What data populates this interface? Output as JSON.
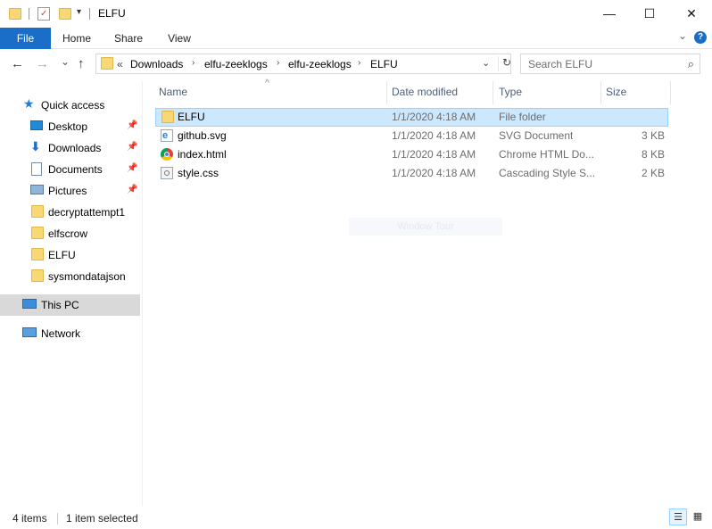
{
  "window": {
    "title": "ELFU",
    "minimize_glyph": "—",
    "maximize_glyph": "☐",
    "close_glyph": "✕"
  },
  "quick_access_toolbar": {
    "dropdown_glyph": "▾"
  },
  "ribbon": {
    "tabs": [
      "File",
      "Home",
      "Share",
      "View"
    ],
    "collapse_glyph": "⌄",
    "help_glyph": "?"
  },
  "navigation": {
    "back_glyph": "←",
    "forward_glyph": "→",
    "recent_glyph": "⌄",
    "up_glyph": "↑",
    "overflow": "«",
    "breadcrumbs": [
      "Downloads",
      "elfu-zeeklogs",
      "elfu-zeeklogs",
      "ELFU"
    ],
    "crumb_separator": "›",
    "dropdown_glyph": "⌄",
    "refresh_glyph": "↻"
  },
  "search": {
    "placeholder": "Search ELFU",
    "icon_glyph": "⌕"
  },
  "sidebar": {
    "pin_glyph": "📌",
    "quick_access_label": "Quick access",
    "items": [
      {
        "label": "Desktop",
        "icon": "desktop-icon",
        "pinned": true
      },
      {
        "label": "Downloads",
        "icon": "downloads-icon",
        "pinned": true
      },
      {
        "label": "Documents",
        "icon": "documents-icon",
        "pinned": true
      },
      {
        "label": "Pictures",
        "icon": "pictures-icon",
        "pinned": true
      },
      {
        "label": "decryptattempt1",
        "icon": "folder-icon",
        "pinned": false
      },
      {
        "label": "elfscrow",
        "icon": "folder-icon",
        "pinned": false
      },
      {
        "label": "ELFU",
        "icon": "folder-icon",
        "pinned": false
      },
      {
        "label": "sysmondatajson",
        "icon": "folder-icon",
        "pinned": false
      }
    ],
    "this_pc_label": "This PC",
    "network_label": "Network"
  },
  "file_list": {
    "sort_glyph": "^",
    "columns": [
      "Name",
      "Date modified",
      "Type",
      "Size"
    ],
    "rows": [
      {
        "name": "ELFU",
        "modified": "1/1/2020 4:18 AM",
        "type": "File folder",
        "size": "",
        "icon": "folder-icon",
        "selected": true
      },
      {
        "name": "github.svg",
        "modified": "1/1/2020 4:18 AM",
        "type": "SVG Document",
        "size": "3 KB",
        "icon": "ie-document-icon",
        "selected": false
      },
      {
        "name": "index.html",
        "modified": "1/1/2020 4:18 AM",
        "type": "Chrome HTML Do...",
        "size": "8 KB",
        "icon": "chrome-icon",
        "selected": false
      },
      {
        "name": "style.css",
        "modified": "1/1/2020 4:18 AM",
        "type": "Cascading Style S...",
        "size": "2 KB",
        "icon": "css-file-icon",
        "selected": false
      }
    ],
    "ghost_text": "Window Tour"
  },
  "status_bar": {
    "item_count": "4 items",
    "selection": "1 item selected",
    "details_view_glyph": "☰",
    "tiles_view_glyph": "▦"
  },
  "colors": {
    "file_tab": "#1a6ec7",
    "selection_fill": "#cce8ff",
    "selection_border": "#99d1ff",
    "folder": "#f8d775",
    "column_header_text": "#4c607a"
  }
}
